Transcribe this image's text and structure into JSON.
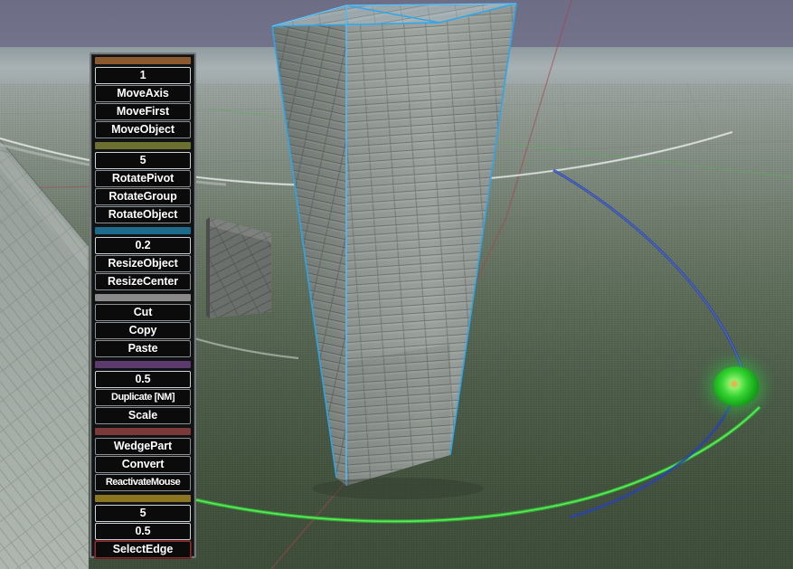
{
  "app": {
    "title": "3D Building Editor Viewport",
    "viewport_name": "3d-scene-viewport"
  },
  "scene": {
    "sky_color": "#6d6d86",
    "fog_color": "#a8b2b4",
    "ground_color": "#4d5d4a",
    "selection_outline_color": "#29a8ef",
    "objects": [
      {
        "name": "selected-tower",
        "material": "brick",
        "selected": true
      },
      {
        "name": "background-wall-left",
        "material": "brick",
        "selected": false
      },
      {
        "name": "dark-slab",
        "material": "brick-dark",
        "selected": false
      }
    ],
    "handles": [
      {
        "name": "green-sphere-handle",
        "color": "#2ee03a",
        "core_color": "#e8a33a"
      }
    ],
    "axis_lines": [
      {
        "name": "axis-line-green",
        "color": "#3bd13b"
      },
      {
        "name": "axis-line-blue",
        "color": "#3355bb"
      },
      {
        "name": "axis-line-red",
        "color": "#b0404a"
      },
      {
        "name": "axis-circle-white",
        "color": "#d8dedc"
      }
    ]
  },
  "panel": {
    "name": "build-tools-panel",
    "groups": [
      {
        "name": "move-group",
        "divider_color": "#8a5a2e",
        "items": [
          {
            "label": "1",
            "type": "value",
            "name": "move-step-value"
          },
          {
            "label": "MoveAxis",
            "type": "button",
            "name": "move-axis-button"
          },
          {
            "label": "MoveFirst",
            "type": "button",
            "name": "move-first-button"
          },
          {
            "label": "MoveObject",
            "type": "button",
            "name": "move-object-button"
          }
        ]
      },
      {
        "name": "rotate-group",
        "divider_color": "#6b7030",
        "items": [
          {
            "label": "5",
            "type": "value",
            "name": "rotate-step-value"
          },
          {
            "label": "RotatePivot",
            "type": "button",
            "name": "rotate-pivot-button"
          },
          {
            "label": "RotateGroup",
            "type": "button",
            "name": "rotate-group-button"
          },
          {
            "label": "RotateObject",
            "type": "button",
            "name": "rotate-object-button"
          }
        ]
      },
      {
        "name": "resize-group",
        "divider_color": "#1d6b8c",
        "items": [
          {
            "label": "0.2",
            "type": "value",
            "name": "resize-step-value"
          },
          {
            "label": "ResizeObject",
            "type": "button",
            "name": "resize-object-button"
          },
          {
            "label": "ResizeCenter",
            "type": "button",
            "name": "resize-center-button"
          }
        ]
      },
      {
        "name": "clipboard-group",
        "divider_color": "#8a8a8a",
        "items": [
          {
            "label": "Cut",
            "type": "button",
            "name": "cut-button"
          },
          {
            "label": "Copy",
            "type": "button",
            "name": "copy-button"
          },
          {
            "label": "Paste",
            "type": "button",
            "name": "paste-button"
          }
        ]
      },
      {
        "name": "duplicate-group",
        "divider_color": "#5d3a6e",
        "items": [
          {
            "label": "0.5",
            "type": "value",
            "name": "duplicate-step-value"
          },
          {
            "label": "Duplicate [NM]",
            "type": "button",
            "name": "duplicate-nm-button"
          },
          {
            "label": "Scale",
            "type": "button",
            "name": "scale-button"
          }
        ]
      },
      {
        "name": "geometry-group",
        "divider_color": "#7a3a3a",
        "items": [
          {
            "label": "WedgePart",
            "type": "button",
            "name": "wedge-part-button"
          },
          {
            "label": "Convert",
            "type": "button",
            "name": "convert-button"
          },
          {
            "label": "ReactivateMouse",
            "type": "button",
            "name": "reactivate-mouse-button"
          }
        ]
      },
      {
        "name": "edge-group",
        "divider_color": "#8a7520",
        "items": [
          {
            "label": "5",
            "type": "value",
            "name": "edge-step-value-a"
          },
          {
            "label": "0.5",
            "type": "value",
            "name": "edge-step-value-b"
          },
          {
            "label": "SelectEdge",
            "type": "button",
            "name": "select-edge-button",
            "highlighted": true
          }
        ]
      }
    ]
  }
}
